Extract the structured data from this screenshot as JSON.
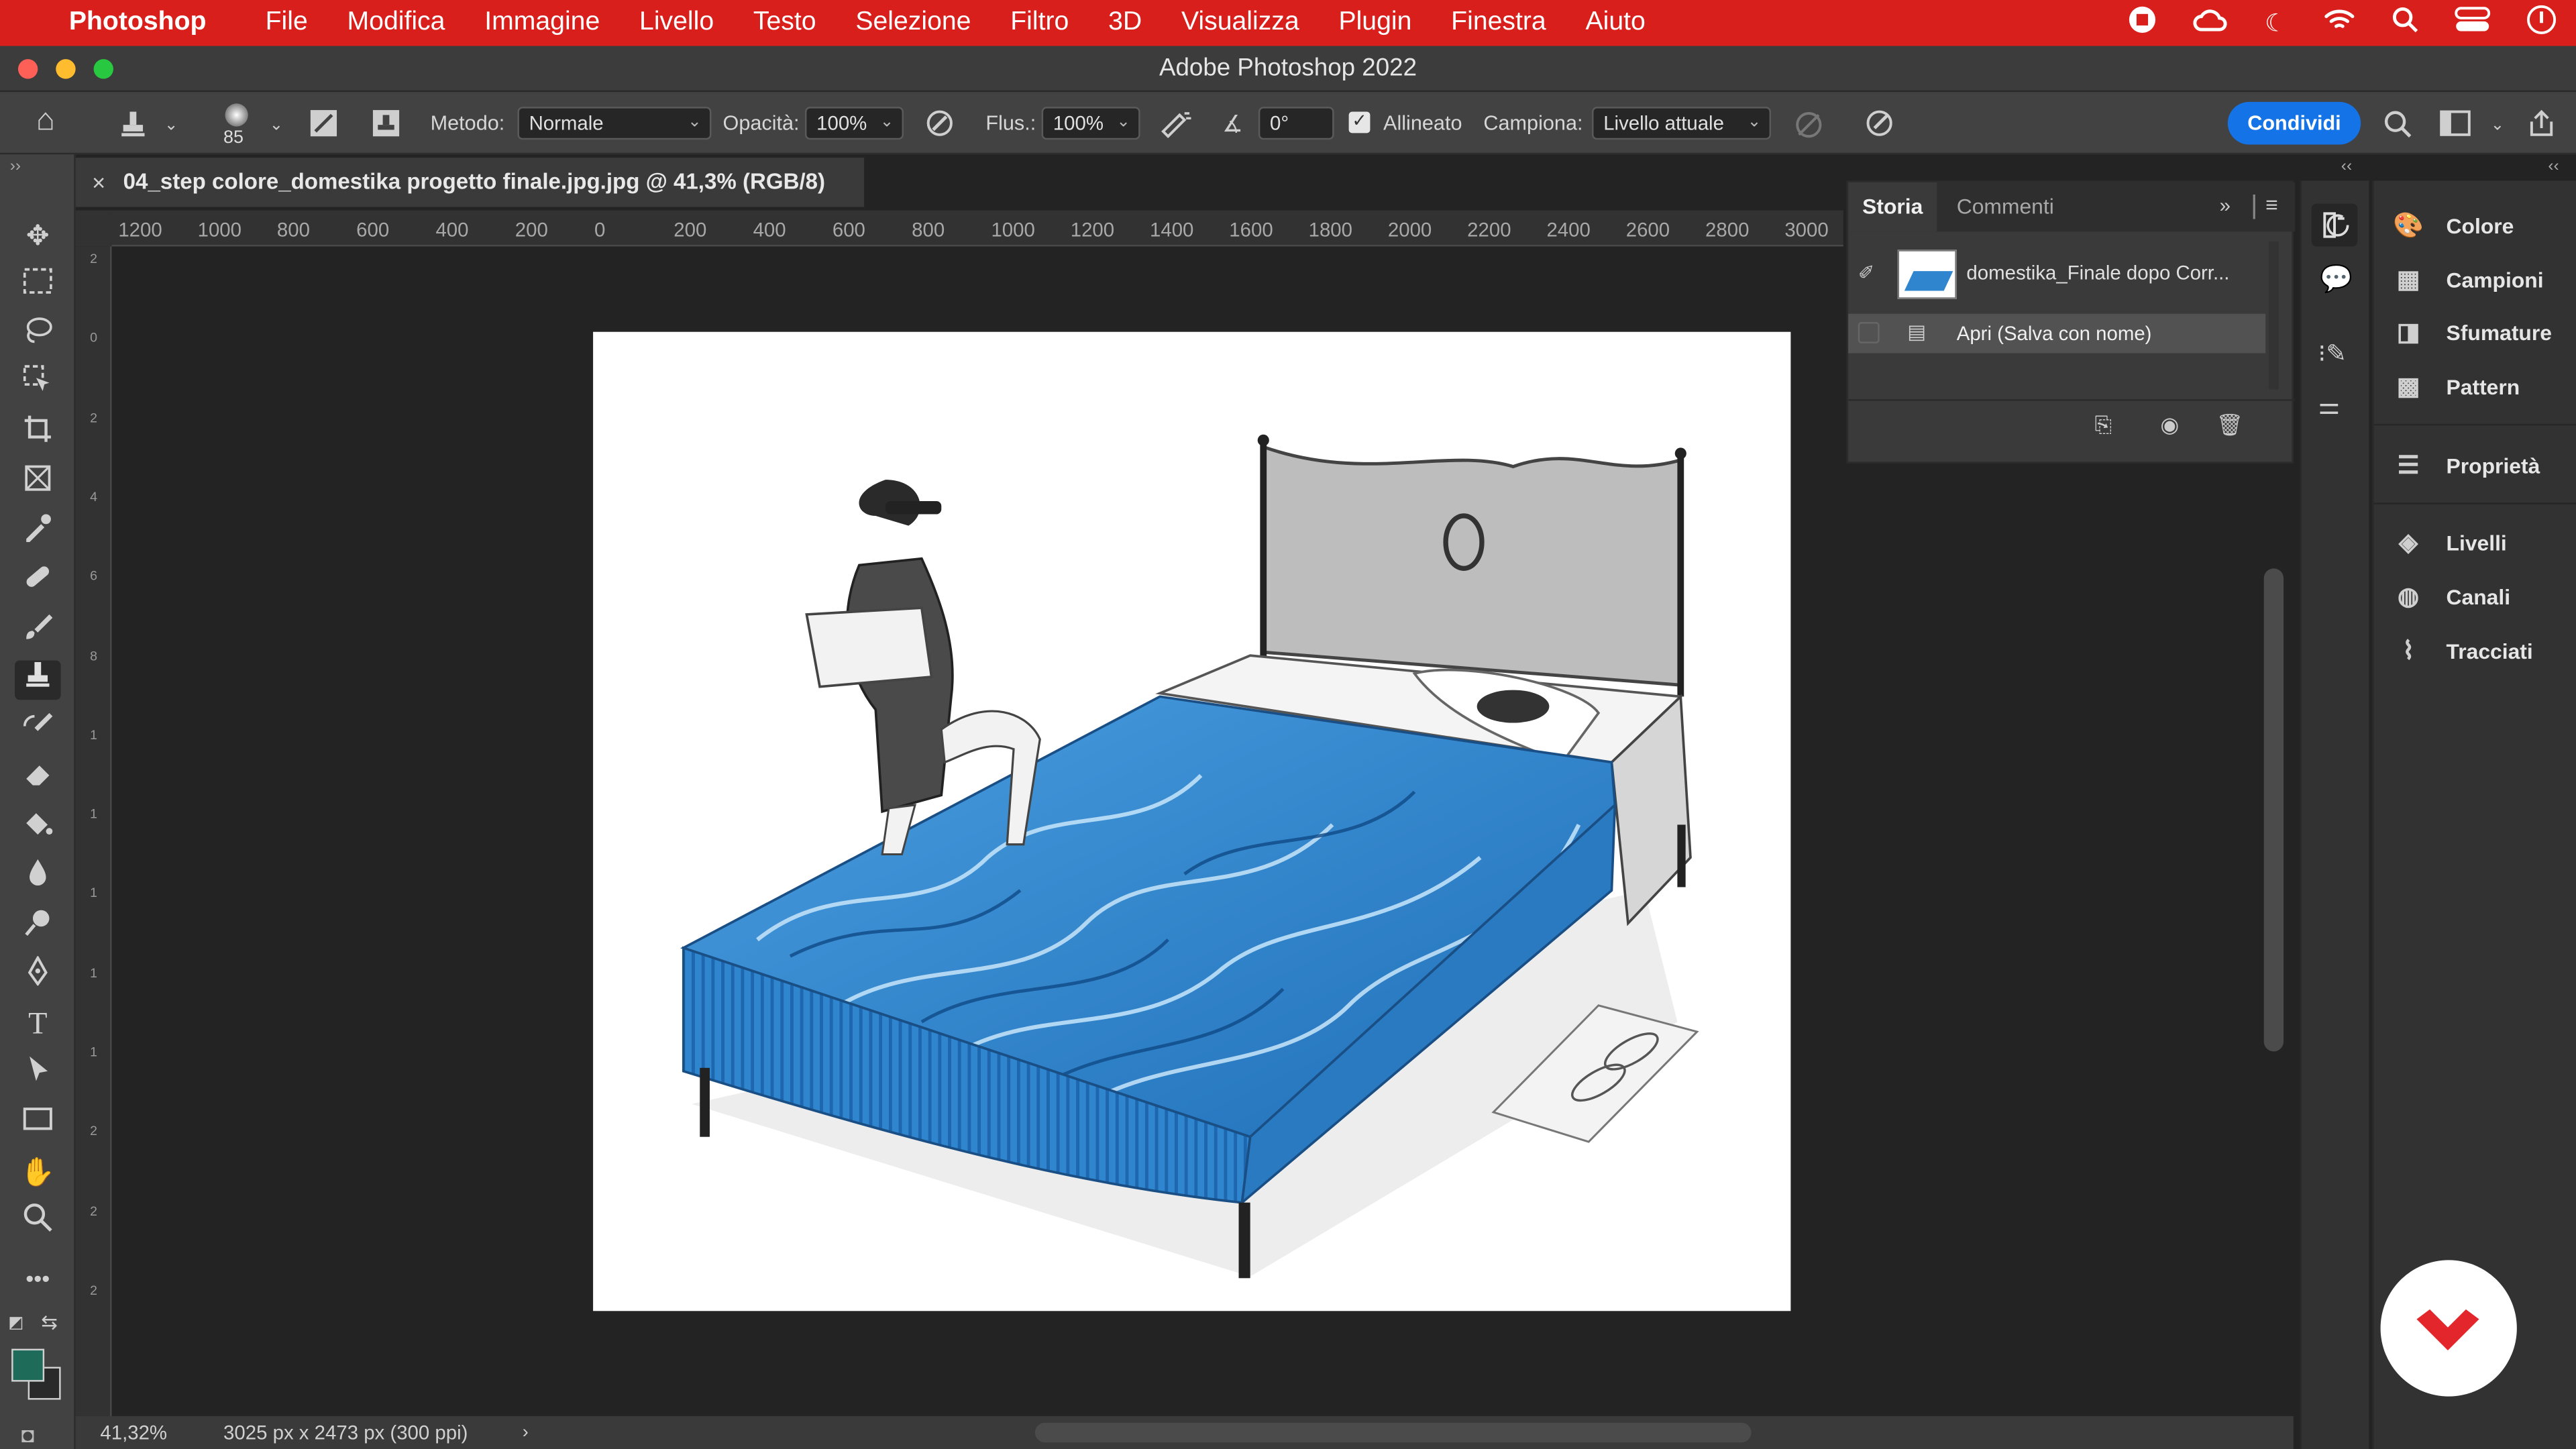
{
  "menubar": {
    "apple_icon": "apple-logo",
    "app_name": "Photoshop",
    "items": [
      "File",
      "Modifica",
      "Immagine",
      "Livello",
      "Testo",
      "Selezione",
      "Filtro",
      "3D",
      "Visualizza",
      "Plugin",
      "Finestra",
      "Aiuto"
    ],
    "status_icons": [
      "record-icon",
      "creative-cloud-icon",
      "moon-icon",
      "wifi-icon",
      "search-icon",
      "control-center-icon",
      "siri-icon"
    ]
  },
  "window": {
    "title": "Adobe Photoshop 2022"
  },
  "options": {
    "brush_size": "85",
    "method_label": "Metodo:",
    "method_value": "Normale",
    "opacity_label": "Opacità:",
    "opacity_value": "100%",
    "flow_label": "Flus.:",
    "flow_value": "100%",
    "angle_value": "0°",
    "aligned_label": "Allineato",
    "aligned_checked": true,
    "sample_label": "Campiona:",
    "sample_value": "Livello attuale",
    "share_label": "Condividi",
    "share_color": "#1473e6"
  },
  "document": {
    "tab_title": "04_step colore_domestika progetto finale.jpg.jpg @ 41,3% (RGB/8)",
    "close_glyph": "×"
  },
  "rulers": {
    "horizontal": [
      "1200",
      "1000",
      "800",
      "600",
      "400",
      "200",
      "0",
      "200",
      "400",
      "600",
      "800",
      "1000",
      "1200",
      "1400",
      "1600",
      "1800",
      "2000",
      "2200",
      "2400",
      "2600",
      "2800",
      "3000"
    ],
    "vertical": [
      "2",
      "0",
      "2",
      "4",
      "6",
      "8",
      "1",
      "1",
      "1",
      "1",
      "1",
      "2",
      "2",
      "2"
    ]
  },
  "status": {
    "zoom": "41,32%",
    "doc_info": "3025 px x 2473 px (300 ppi)"
  },
  "history_panel": {
    "tabs": [
      "Storia",
      "Commenti"
    ],
    "active_tab": "Storia",
    "snapshot_label": "domestika_Finale dopo Corr...",
    "step_label": "Apri (Salva con nome)",
    "footer_icons": [
      "new-document-from-state-icon",
      "camera-snapshot-icon",
      "trash-icon"
    ]
  },
  "right_panel": {
    "items": [
      {
        "label": "Colore",
        "icon": "color-palette-icon"
      },
      {
        "label": "Campioni",
        "icon": "swatches-grid-icon"
      },
      {
        "label": "Sfumature",
        "icon": "gradient-icon"
      },
      {
        "label": "Pattern",
        "icon": "pattern-icon"
      },
      {
        "label": "Proprietà",
        "icon": "properties-sliders-icon"
      },
      {
        "label": "Livelli",
        "icon": "layers-icon"
      },
      {
        "label": "Canali",
        "icon": "channels-icon"
      },
      {
        "label": "Tracciati",
        "icon": "paths-icon"
      }
    ]
  },
  "colors": {
    "menubar": "#d91f1b",
    "foreground_swatch": "#1f6b5a",
    "background_swatch": "#2a2a2a",
    "blanket_blue": "#2f86cf"
  }
}
